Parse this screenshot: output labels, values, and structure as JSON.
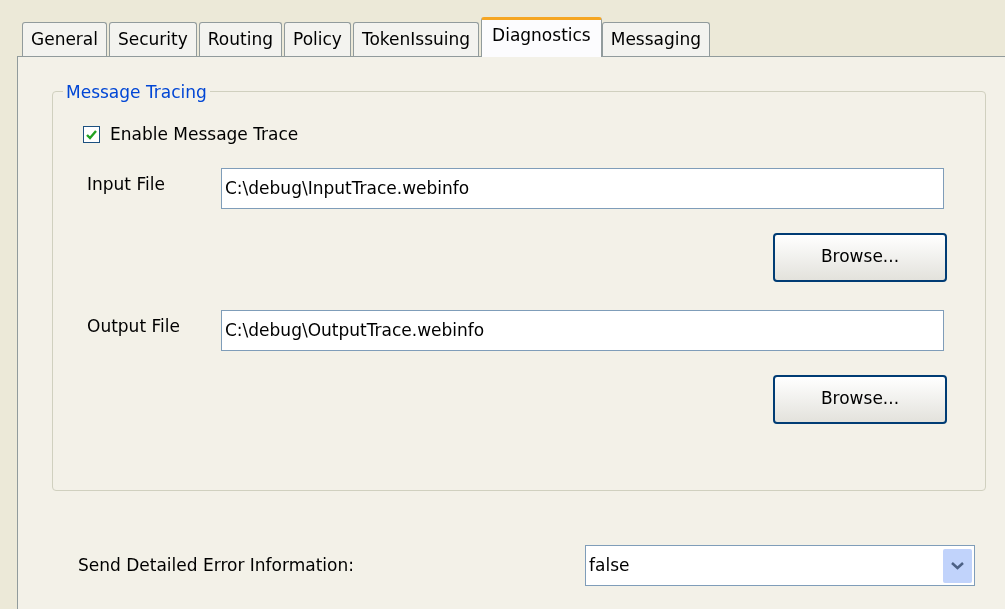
{
  "tabs": [
    {
      "label": "General",
      "selected": false
    },
    {
      "label": "Security",
      "selected": false
    },
    {
      "label": "Routing",
      "selected": false
    },
    {
      "label": "Policy",
      "selected": false
    },
    {
      "label": "TokenIssuing",
      "selected": false
    },
    {
      "label": "Diagnostics",
      "selected": true
    },
    {
      "label": "Messaging",
      "selected": false
    }
  ],
  "group": {
    "title": "Message Tracing",
    "enable": {
      "label": "Enable Message Trace",
      "checked": true
    },
    "files": [
      {
        "label": "Input File",
        "value": "C:\\debug\\InputTrace.webinfo",
        "button": "Browse..."
      },
      {
        "label": "Output File",
        "value": "C:\\debug\\OutputTrace.webinfo",
        "button": "Browse..."
      }
    ]
  },
  "error_info": {
    "label": "Send Detailed Error Information:",
    "value": "false"
  }
}
